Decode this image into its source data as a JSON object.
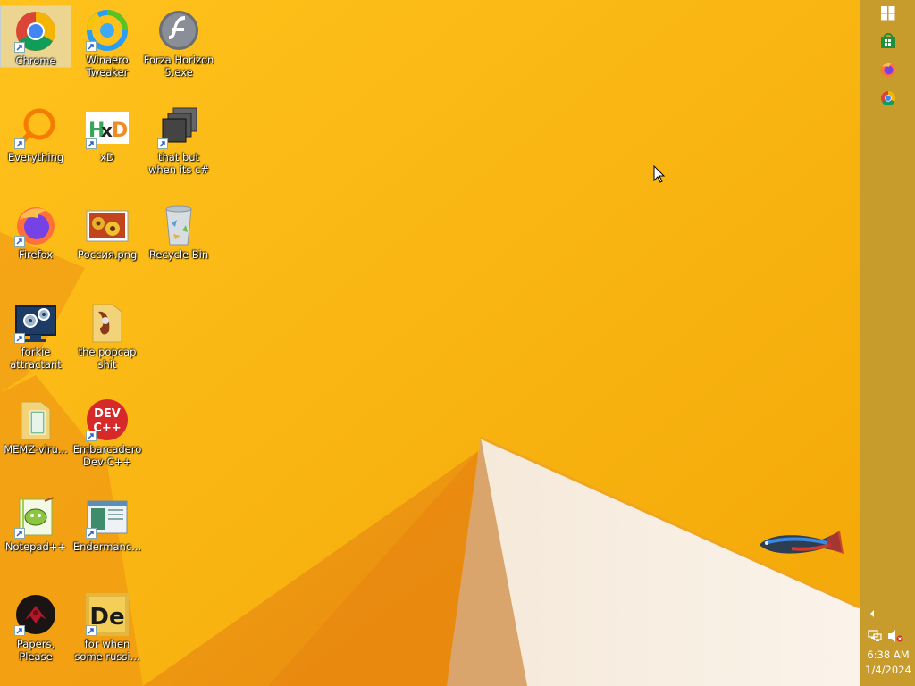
{
  "desktop": {
    "icons": [
      {
        "label": "Chrome",
        "icon": "chrome-icon"
      },
      {
        "label": "Winaero Tweaker",
        "icon": "winaero-tweaker-icon"
      },
      {
        "label": "Forza Horizon 5.exe",
        "icon": "flash-icon"
      },
      {
        "label": "Everything",
        "icon": "everything-search-icon"
      },
      {
        "label": "xD",
        "icon": "hxd-icon"
      },
      {
        "label": "that but when its c#",
        "icon": "stacked-windows-icon"
      },
      {
        "label": "Firefox",
        "icon": "firefox-icon"
      },
      {
        "label": "Россия.png",
        "icon": "image-file-icon"
      },
      {
        "label": "Recycle Bin",
        "icon": "recycle-bin-icon"
      },
      {
        "label": "forkie attractant",
        "icon": "monitor-gears-icon"
      },
      {
        "label": "the popcap shit",
        "icon": "folder-icon"
      },
      {
        "label": "MEMZ-viru...",
        "icon": "folder-icon"
      },
      {
        "label": "Embarcadero Dev-C++",
        "icon": "devcpp-icon"
      },
      {
        "label": "Notepad++",
        "icon": "notepadpp-icon"
      },
      {
        "label": "Endermanc...",
        "icon": "window-app-icon"
      },
      {
        "label": "Papers, Please",
        "icon": "papers-please-icon"
      },
      {
        "label": "for when some russi...",
        "icon": "de-app-icon"
      }
    ]
  },
  "taskbar": {
    "pinned": [
      {
        "name": "windows-start-icon"
      },
      {
        "name": "store-icon"
      },
      {
        "name": "firefox-icon"
      },
      {
        "name": "chrome-icon"
      }
    ],
    "tray": {
      "expand_icon": "chevron-left-icon",
      "network_icon": "network-icon",
      "volume_icon": "volume-muted-icon"
    },
    "clock": {
      "time": "6:38 AM",
      "date": "1/4/2024"
    }
  },
  "colors": {
    "wallpaper": "#f7b512",
    "taskbar": "#c79b2c"
  }
}
